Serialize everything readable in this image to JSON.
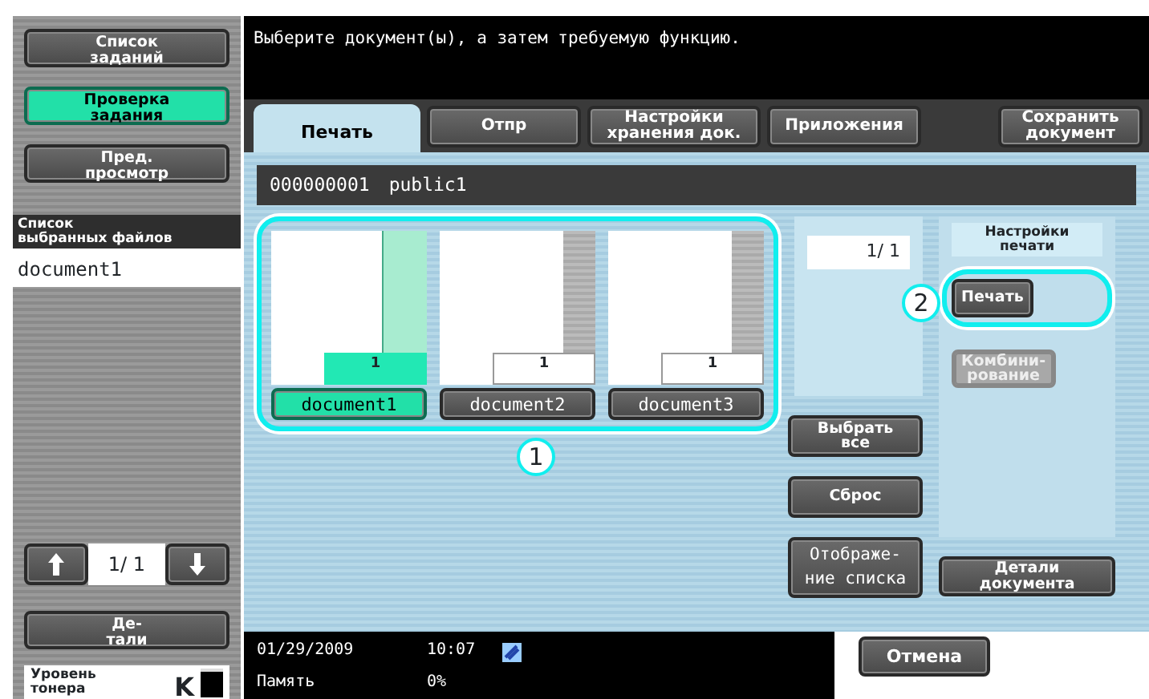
{
  "instruction": "Выберите документ(ы), а затем требуемую функцию.",
  "sidebar": {
    "buttons": [
      {
        "label": "Список\nзаданий",
        "selected": false
      },
      {
        "label": "Проверка\nзадания",
        "selected": true
      },
      {
        "label": "Пред.\nпросмотр",
        "selected": false
      }
    ],
    "selected_files": {
      "title": "Список\nвыбранных файлов",
      "items": [
        "document1"
      ]
    },
    "pager": {
      "page": "1/  1"
    },
    "details_button": "Де-\nтали",
    "toner": {
      "label": "Уровень\nтонера",
      "letter": "K",
      "level": 0.9
    }
  },
  "tabs": [
    {
      "label": "Печать",
      "selected": true
    },
    {
      "label": "Отпр",
      "selected": false
    },
    {
      "label": "Настройки\nхранения док.",
      "selected": false
    },
    {
      "label": "Приложения",
      "selected": false
    }
  ],
  "save_button": "Сохранить\nдокумент",
  "job": {
    "number": "000000001",
    "name": "public1"
  },
  "documents": [
    {
      "name": "document1",
      "pages": "1",
      "selected": true
    },
    {
      "name": "document2",
      "pages": "1",
      "selected": false
    },
    {
      "name": "document3",
      "pages": "1",
      "selected": false
    }
  ],
  "callouts": [
    "1",
    "2"
  ],
  "page_counter": "1/  1",
  "actions": [
    "Выбрать\nвсе",
    "Сброс",
    "Отображе-\nние списка"
  ],
  "print_settings": {
    "title": "Настройки\nпечати",
    "buttons": [
      {
        "label": "Печать",
        "disabled": false
      },
      {
        "label": "Комбини-\nрование",
        "disabled": true
      }
    ]
  },
  "doc_details_button": "Детали\nдокумента",
  "status": {
    "date": "01/29/2009",
    "time": "10:07",
    "memory_label": "Память",
    "memory_value": "0%"
  },
  "cancel_button": "Отмена"
}
